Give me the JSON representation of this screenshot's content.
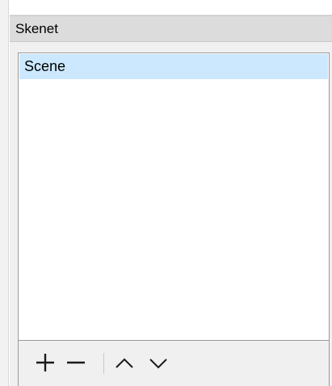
{
  "dock": {
    "title": "Skenet"
  },
  "scenes": {
    "items": [
      {
        "label": "Scene",
        "selected": true
      }
    ]
  },
  "toolbar": {
    "icons": [
      "add-icon",
      "remove-icon",
      "move-up-icon",
      "move-down-icon"
    ]
  },
  "colors": {
    "title_bar": "#dcdcdc",
    "selection": "#cce8ff",
    "panel_bg": "#f0f0f0",
    "border": "#9a9a9a"
  }
}
